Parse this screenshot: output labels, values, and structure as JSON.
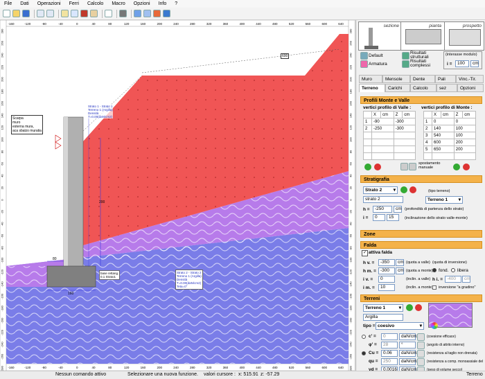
{
  "menu": [
    "File",
    "Dati",
    "Operazioni",
    "Ferri",
    "Calcolo",
    "Macro",
    "Opzioni",
    "Info",
    "?"
  ],
  "ruler": {
    "top_ticks": [
      "-160",
      "-120",
      "-80",
      "-40",
      "0",
      "40",
      "80",
      "120",
      "160",
      "200",
      "240",
      "280",
      "320",
      "360",
      "400",
      "440",
      "480",
      "520",
      "560",
      "600",
      "640"
    ],
    "left_ticks": [
      "280",
      "260",
      "240",
      "220",
      "200",
      "180",
      "160",
      "140",
      "120",
      "100",
      "80",
      "60",
      "40",
      "20",
      "0",
      "-20",
      "-40",
      "-60",
      "-80",
      "-100",
      "-120",
      "-140",
      "-160",
      "-180",
      "-200",
      "-220",
      "-240",
      "-260",
      "-280"
    ]
  },
  "canvas_labels": {
    "strato1": "Strato 1 - Strato 1\nTerreno 1 (Argilla)\nDensità\nT=0.00(daN/cm2)",
    "strato2": "Strato 2 - Strato 2\nTerreno 1 (Argilla)\nDensità\nT=0.00(daN/cm2)\nTeta=0°",
    "left_note": "Scarpa\nmuro\nesterna mura,\naca sbalzo muratia",
    "base_note": "base rettang.\n0.1 Strato1",
    "dim_600": "600",
    "dim_80": "80",
    "dim_160": "160",
    "dim_200": "200"
  },
  "preview": {
    "sezione": "sezione",
    "pianta": "pianta",
    "prospetto": "prospetto"
  },
  "options": {
    "default": "Default",
    "armatura": "Armatura",
    "risultati_strutturali": "Risultati\nstrutturali",
    "risultati_complessivi": "Risultati\ncomplessi",
    "interasse_label": "(interasse modulo)",
    "interasse_var": "i =",
    "interasse_value": "100",
    "interasse_unit": "cm"
  },
  "tabs_row1": [
    "Muro",
    "Mensole",
    "Dente",
    "Pali",
    "Vinc.-Tir."
  ],
  "tabs_row2": [
    "Terreno",
    "Carichi",
    "Calcolo",
    "sez",
    "Opzioni"
  ],
  "profili": {
    "title": "Profili Monte e Valle",
    "valle_label": "vertici profilo di Valle :",
    "monte_label": "vertici profilo di Monte :",
    "col_x": "X",
    "col_z": "Z",
    "col_unit": "cm",
    "valle_rows": [
      [
        "1",
        "-90",
        "-300"
      ],
      [
        "2",
        "-250",
        "-300"
      ]
    ],
    "monte_rows": [
      [
        "1",
        "0",
        "0"
      ],
      [
        "2",
        "140",
        "100"
      ],
      [
        "3",
        "540",
        "100"
      ],
      [
        "4",
        "600",
        "200"
      ],
      [
        "5",
        "650",
        "200"
      ]
    ],
    "spostamento": "spostamento\nmanuale"
  },
  "stratigrafia": {
    "title": "Stratigrafia",
    "strato_select": "Strato 2",
    "strato_name": "strato 2",
    "tipo_terreno": "(tipo terreno)",
    "terreno_select": "Terreno 1",
    "h_label": "h =",
    "h_value": "-250",
    "h_unit": "cm",
    "h_note": "(profondità di partenza dello strato)",
    "i_label": "i =",
    "i_value": "0",
    "i_value2": "15",
    "i_note": "(inclinazione dello strato valle-monte)"
  },
  "zone": {
    "title": "Zone"
  },
  "falda": {
    "title": "Falda",
    "attiva": "attiva falda",
    "hv_label": "h v. =",
    "hv_value": "-350",
    "hv_unit": "cm",
    "hv_note": "(quota a valle)",
    "hm_label": "h m. =",
    "hm_value": "-300",
    "hm_unit": "cm",
    "hm_note": "(quota a monte)",
    "iv_label": "i v. =",
    "iv_value": "0",
    "iv_note": "(inclin. a valle)",
    "im_label": "i m. =",
    "im_value": "10",
    "im_note": "(inclin. a monte)",
    "quota_inversione": "(quota di inversione)",
    "fond": "fond.",
    "libera": "libera",
    "hi_label": "h i. =",
    "hi_value": "-400",
    "hi_unit": "cm",
    "inversione_gradino": "inversione \"a gradino\""
  },
  "terreni": {
    "title": "Terreni",
    "select": "Terreno 1",
    "name": "Argilla",
    "tipo_label": "tipo =",
    "tipo_value": "coesivo",
    "rows": [
      {
        "label": "c' =",
        "value": "0",
        "unit": "daN/cm2",
        "note": "(coesione efficace)"
      },
      {
        "label": "φ' =",
        "value": "28",
        "unit": "°",
        "note": "(angolo di attrito interno)"
      },
      {
        "label": "Cu =",
        "value": "0.06",
        "unit": "daN/cm2",
        "note": "(resistenza al taglio non drenata)"
      },
      {
        "label": "qu =",
        "value": "250",
        "unit": "daN/cm2",
        "note": "(resistenza a comp. monoassiale del"
      },
      {
        "label": "γd =",
        "value": "0.0016",
        "unit": "daN/cm3",
        "note": "(peso di volume secco)"
      }
    ]
  },
  "status": {
    "left": "Nessun comando attivo",
    "middle": "Selezionare una nuova funzione.",
    "cursor_label": "valori cursore :",
    "cursor_x": "x: 515.91",
    "cursor_z": "z: -57.29",
    "right": "Terreno"
  },
  "colors": {
    "fill_red": "#f05050",
    "purple": "#a066e0",
    "blue": "#7a7de8",
    "accent": "#f4b24a"
  }
}
